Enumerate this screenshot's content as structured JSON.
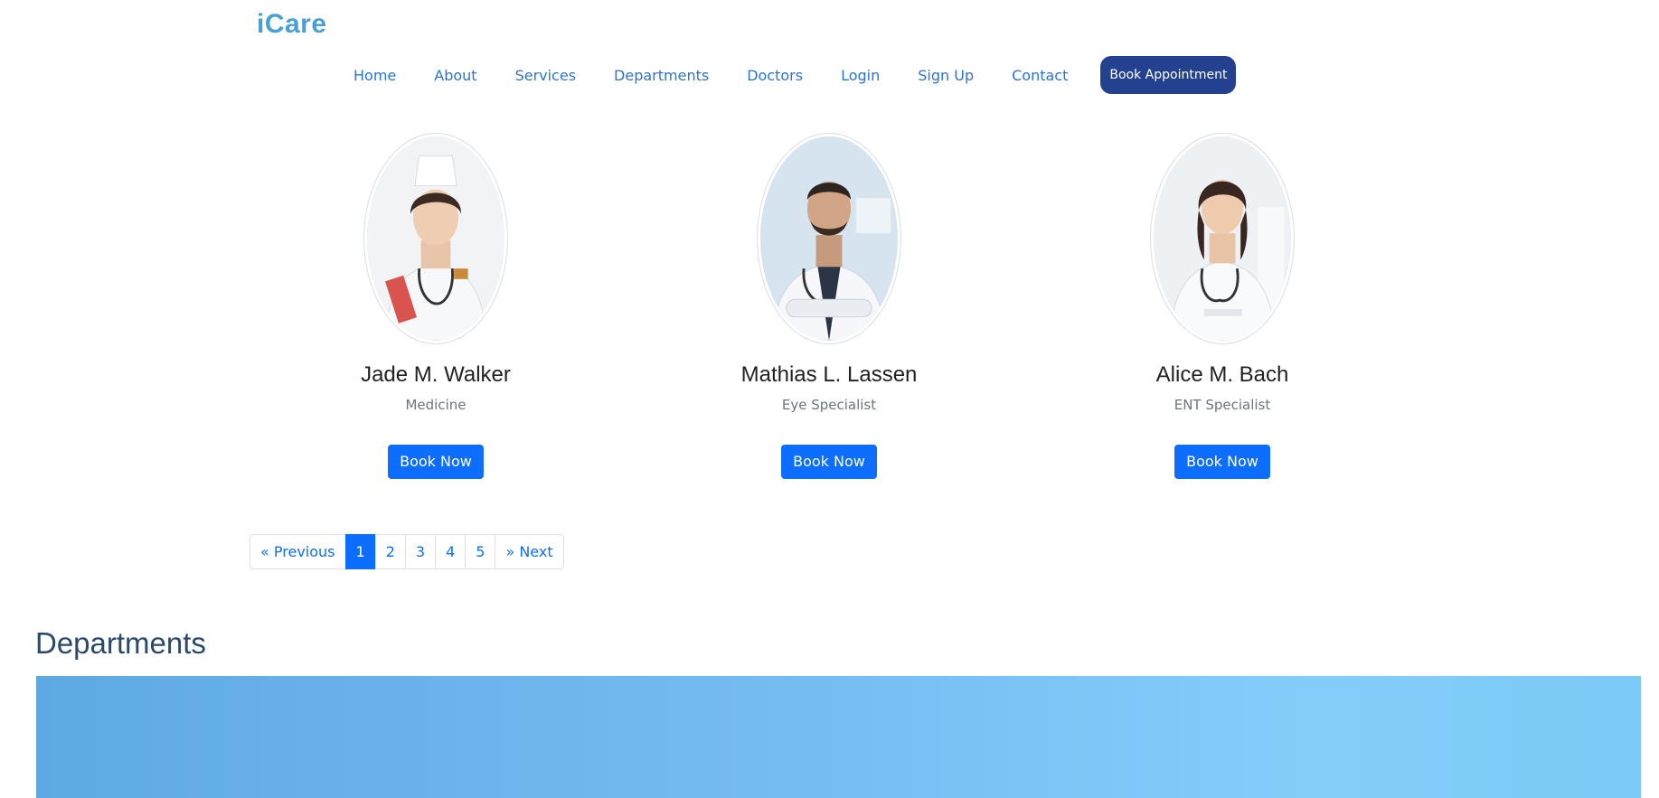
{
  "brand": {
    "name": "iCare"
  },
  "nav": {
    "links": [
      "Home",
      "About",
      "Services",
      "Departments",
      "Doctors",
      "Login",
      "Sign Up",
      "Contact"
    ],
    "cta_label": "Book Appointment"
  },
  "doctors": [
    {
      "name": "Jade M. Walker",
      "specialty": "Medicine",
      "button_label": "Book Now",
      "photo_icon": "female-doctor-photo"
    },
    {
      "name": "Mathias L. Lassen",
      "specialty": "Eye Specialist",
      "button_label": "Book Now",
      "photo_icon": "male-doctor-photo"
    },
    {
      "name": "Alice M. Bach",
      "specialty": "ENT Specialist",
      "button_label": "Book Now",
      "photo_icon": "female-doctor-photo"
    }
  ],
  "pagination": {
    "previous_label": "« Previous",
    "pages": [
      "1",
      "2",
      "3",
      "4",
      "5"
    ],
    "active_page": "1",
    "next_label": "» Next"
  },
  "departments": {
    "title": "Departments"
  },
  "colors": {
    "brand": "#4a9fd4",
    "nav_link": "#2a74d6",
    "cta_bg": "#24418f",
    "primary_button": "#0d6efd",
    "section_title": "#2b4a6b",
    "banner": "#72b9ef"
  }
}
